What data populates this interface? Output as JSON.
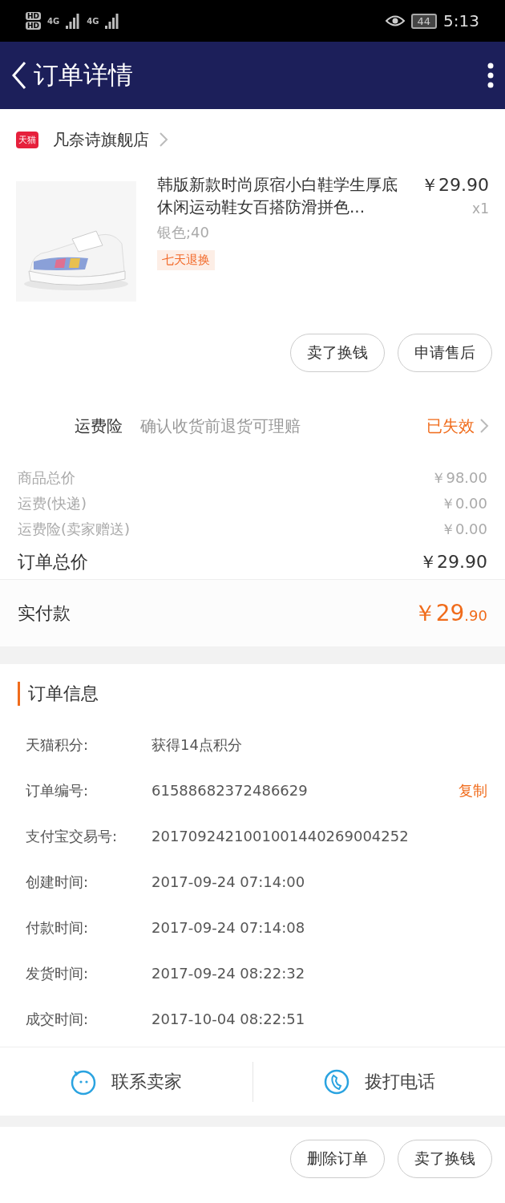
{
  "status_bar": {
    "sim_labels": [
      "HD",
      "HD"
    ],
    "network": [
      "4G",
      "4G"
    ],
    "battery": "44",
    "time": "5:13"
  },
  "header": {
    "title": "订单详情"
  },
  "shop": {
    "badge": "天猫",
    "name": "凡奈诗旗舰店"
  },
  "product": {
    "kind": "picture",
    "title": "韩版新款时尚原宿小白鞋学生厚底休闲运动鞋女百搭防滑拼色...",
    "price": "￥29.90",
    "quantity": "x1",
    "sku": "银色;40",
    "tag": "七天退换"
  },
  "item_actions": [
    "卖了换钱",
    "申请售后"
  ],
  "insurance": {
    "label": "运费险",
    "description": "确认收货前退货可理赔",
    "status": "已失效"
  },
  "price_rows": [
    {
      "label": "商品总价",
      "value": "￥98.00",
      "kind": "minor"
    },
    {
      "label": "运费(快递)",
      "value": "￥0.00",
      "kind": "minor"
    },
    {
      "label": "运费险(卖家赠送)",
      "value": "￥0.00",
      "kind": "minor"
    },
    {
      "label": "订单总价",
      "value": "￥29.90",
      "kind": "total"
    }
  ],
  "paid": {
    "label": "实付款",
    "amount_main": "￥29",
    "amount_fraction": ".90"
  },
  "order_info": {
    "title": "订单信息",
    "rows": [
      {
        "label": "天猫积分:",
        "value": "获得14点积分"
      },
      {
        "label": "订单编号:",
        "value": "61588682372486629",
        "action": "复制"
      },
      {
        "label": "支付宝交易号:",
        "value": "2017092421001001440269004252"
      },
      {
        "label": "创建时间:",
        "value": "2017-09-24 07:14:00"
      },
      {
        "label": "付款时间:",
        "value": "2017-09-24 07:14:08"
      },
      {
        "label": "发货时间:",
        "value": "2017-09-24 08:22:32"
      },
      {
        "label": "成交时间:",
        "value": "2017-10-04 08:22:51"
      }
    ]
  },
  "contact_bar": [
    {
      "label": "联系卖家",
      "kind": "chat"
    },
    {
      "label": "拨打电话",
      "kind": "phone"
    }
  ],
  "bottom_actions": [
    "删除订单",
    "卖了换钱"
  ]
}
